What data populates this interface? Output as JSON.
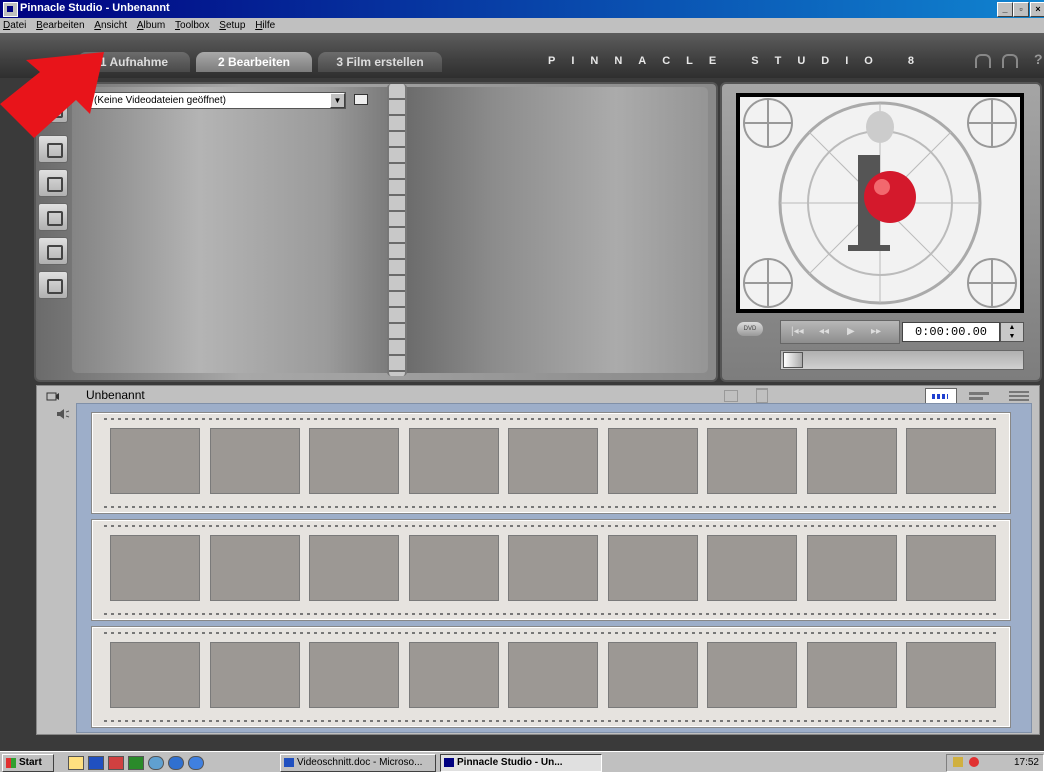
{
  "window": {
    "title": "Pinnacle Studio - Unbenannt"
  },
  "menu": [
    "Datei",
    "Bearbeiten",
    "Ansicht",
    "Album",
    "Toolbox",
    "Setup",
    "Hilfe"
  ],
  "tabs": [
    {
      "label": "1 Aufnahme"
    },
    {
      "label": "2 Bearbeiten"
    },
    {
      "label": "3 Film erstellen"
    }
  ],
  "brand": "PINNACLE STUDIO 8",
  "album": {
    "select_value": "(Keine Videodateien geöffnet)"
  },
  "player": {
    "timecode": "0:00:00.00",
    "position": 0.0
  },
  "storyboard": {
    "title": "Unbenannt",
    "rows": 3,
    "frames_per_row": 9
  },
  "taskbar": {
    "start": "Start",
    "tasks": [
      "Videoschnitt.doc - Microso...",
      "Pinnacle Studio - Un..."
    ],
    "clock": "17:52"
  },
  "colors": {
    "titlebar": "#000080",
    "arrow": "#e8141a",
    "storyboard_bg": "#9daec9"
  }
}
